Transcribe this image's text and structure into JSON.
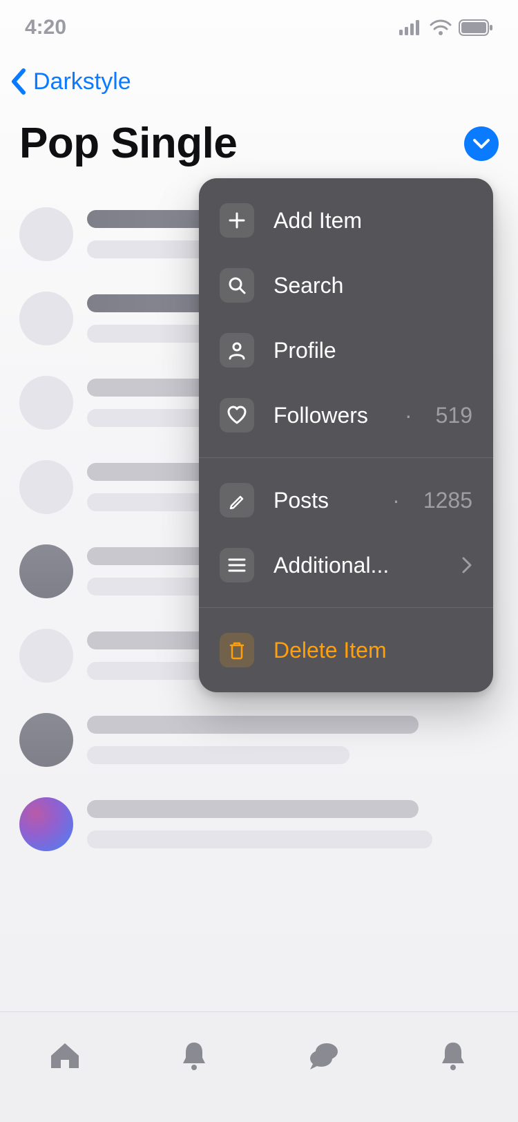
{
  "status_bar": {
    "time": "4:20"
  },
  "nav": {
    "back_label": "Darkstyle"
  },
  "page": {
    "title": "Pop Single"
  },
  "menu": {
    "add_item": "Add Item",
    "search": "Search",
    "profile": "Profile",
    "followers_label": "Followers",
    "followers_count": "519",
    "posts_label": "Posts",
    "posts_count": "1285",
    "additional": "Additional...",
    "delete": "Delete Item",
    "sep": "·"
  }
}
